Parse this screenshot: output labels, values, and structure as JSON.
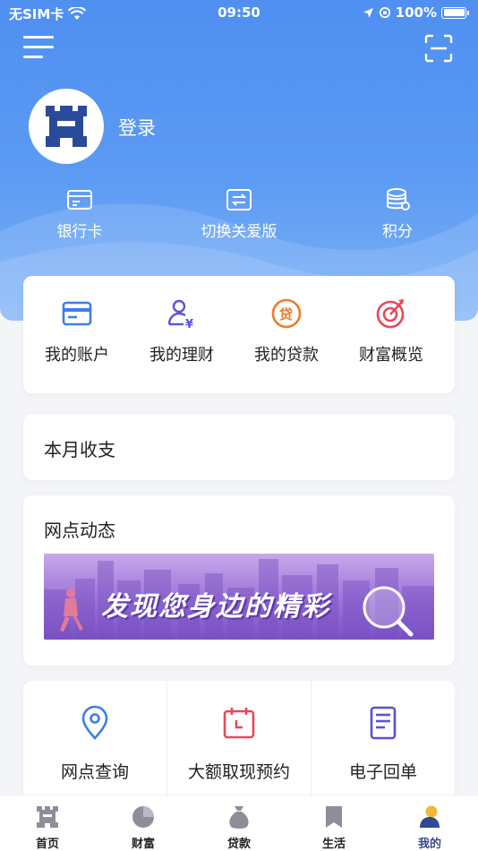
{
  "status_bar": {
    "carrier": "无SIM卡",
    "time": "09:50",
    "battery": "100%"
  },
  "header": {
    "login_label": "登录",
    "quick_links": [
      {
        "label": "银行卡",
        "icon": "bank-card-icon"
      },
      {
        "label": "切换关爱版",
        "icon": "switch-care-icon"
      },
      {
        "label": "积分",
        "icon": "points-icon"
      }
    ]
  },
  "accounts": [
    {
      "label": "我的账户",
      "icon": "account-icon"
    },
    {
      "label": "我的理财",
      "icon": "finance-icon"
    },
    {
      "label": "我的贷款",
      "icon": "loan-icon"
    },
    {
      "label": "财富概览",
      "icon": "wealth-overview-icon"
    }
  ],
  "monthly": {
    "title": "本月收支"
  },
  "branch": {
    "title": "网点动态",
    "banner_text": "发现您身边的精彩"
  },
  "services": [
    {
      "label": "网点查询",
      "icon": "location-pin-icon"
    },
    {
      "label": "大额取现预约",
      "icon": "calendar-icon"
    },
    {
      "label": "电子回单",
      "icon": "receipt-icon"
    }
  ],
  "tabbar": [
    {
      "label": "首页",
      "icon": "home-icon"
    },
    {
      "label": "财富",
      "icon": "wealth-icon"
    },
    {
      "label": "贷款",
      "icon": "loan-bag-icon"
    },
    {
      "label": "生活",
      "icon": "life-icon"
    },
    {
      "label": "我的",
      "icon": "profile-icon",
      "active": true
    }
  ],
  "colors": {
    "header_blue": "#5c9bf3",
    "icon_blue": "#3d7fe6",
    "icon_purple": "#5b52d6",
    "icon_orange": "#ef7a2a",
    "icon_red": "#e8485a",
    "tab_active": "#3a4a86"
  }
}
